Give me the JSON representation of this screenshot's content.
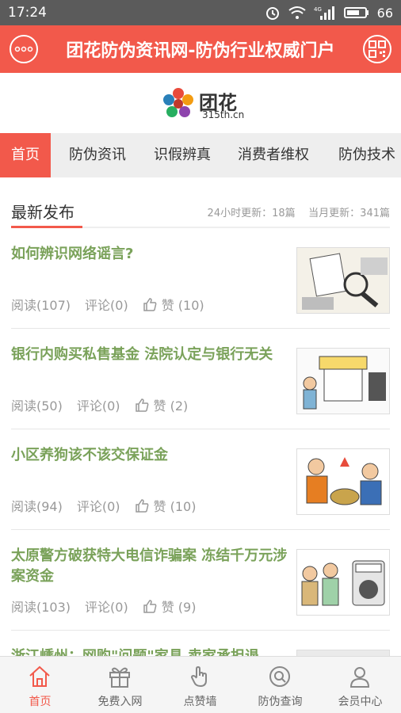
{
  "statusbar": {
    "time": "17:24",
    "network": "4G",
    "battery": "66"
  },
  "header": {
    "title": "团花防伪资讯网-防伪行业权威门户"
  },
  "logo": {
    "name": "团花",
    "url": "315th.cn"
  },
  "nav": {
    "tabs": [
      "首页",
      "防伪资讯",
      "识假辨真",
      "消费者维权",
      "防伪技术"
    ],
    "active": 0
  },
  "section": {
    "title": "最新发布",
    "stat_24h": "24小时更新：18篇",
    "stat_month": "当月更新：341篇"
  },
  "articles": [
    {
      "title": "如何辨识网络谣言?",
      "reads": "阅读(107)",
      "comments": "评论(0)",
      "likes": "赞 (10)"
    },
    {
      "title": "银行内购买私售基金 法院认定与银行无关",
      "reads": "阅读(50)",
      "comments": "评论(0)",
      "likes": "赞 (2)"
    },
    {
      "title": "小区养狗该不该交保证金",
      "reads": "阅读(94)",
      "comments": "评论(0)",
      "likes": "赞 (10)"
    },
    {
      "title": "太原警方破获特大电信诈骗案 冻结千万元涉案资金",
      "reads": "阅读(103)",
      "comments": "评论(0)",
      "likes": "赞 (9)"
    },
    {
      "title": "浙江嵊州：网购\"问题\"家具 卖家承担退",
      "reads": "",
      "comments": "",
      "likes": ""
    }
  ],
  "tabbar": {
    "items": [
      "首页",
      "免费入网",
      "点赞墙",
      "防伪查询",
      "会员中心"
    ],
    "active": 0
  },
  "colors": {
    "brand": "#f2594b",
    "title_green": "#7aa25a"
  }
}
